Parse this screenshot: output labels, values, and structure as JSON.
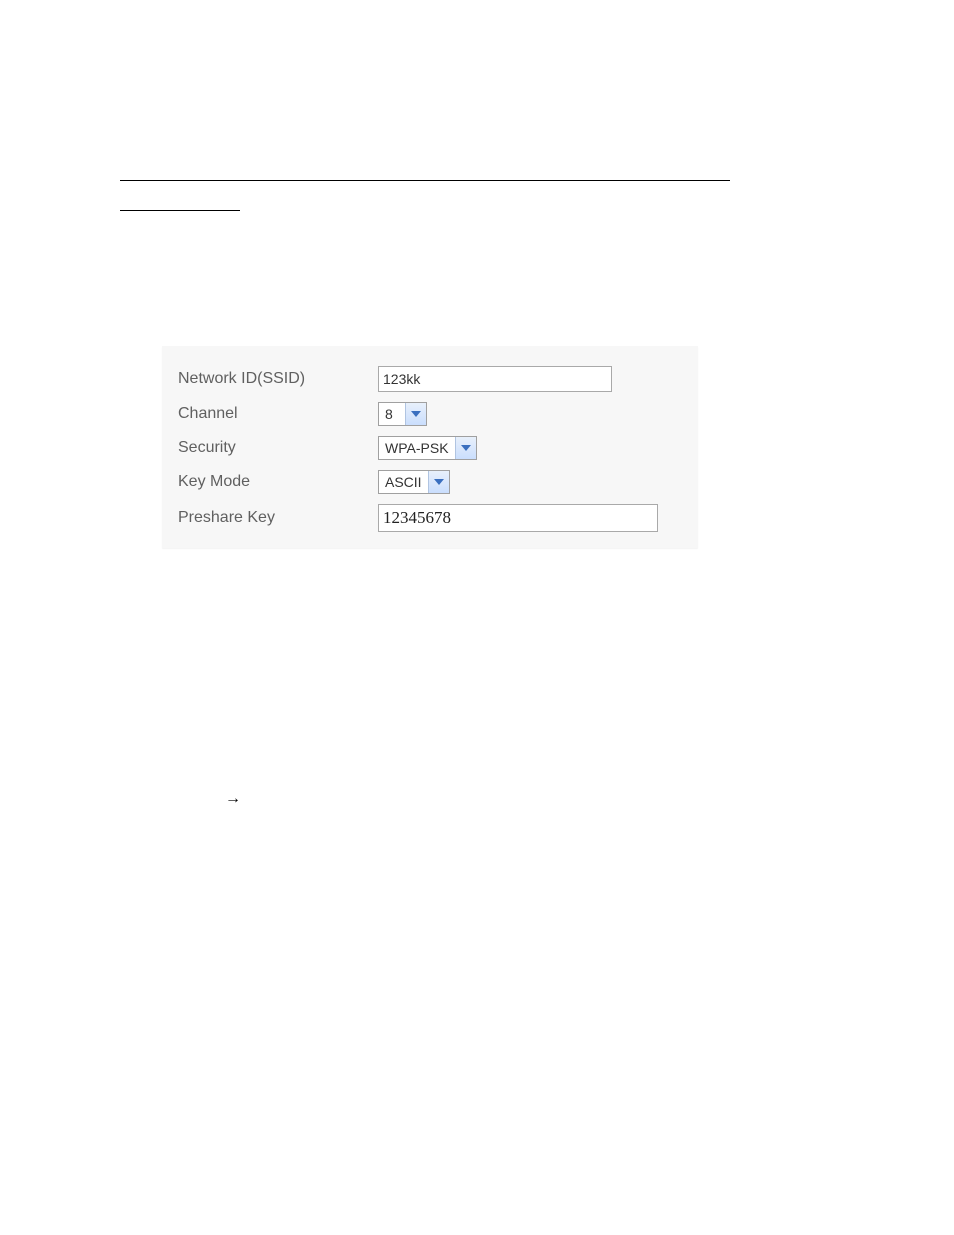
{
  "labels": {
    "ssid": "Network ID(SSID)",
    "channel": "Channel",
    "security": "Security",
    "keymode": "Key Mode",
    "preshare": "Preshare Key"
  },
  "values": {
    "ssid": "123kk",
    "channel": "8",
    "security": "WPA-PSK",
    "keymode": "ASCII",
    "preshare": "12345678"
  },
  "misc": {
    "arrow": "→"
  }
}
